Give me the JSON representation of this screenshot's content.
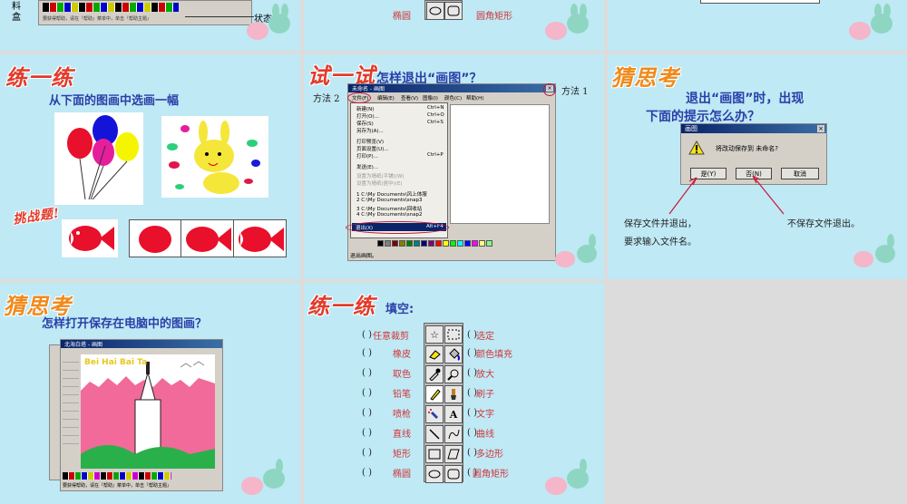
{
  "top_left": {
    "label_toolbox": "料\n盒",
    "label_statusbar": "状态栏",
    "status_text": "要获得帮助，请在『帮助』菜单中，单击『帮助主题』"
  },
  "top_middle": {
    "label_ellipse": "椭圆",
    "label_rounded_rect": "圆角矩形"
  },
  "practice1": {
    "heading": "练一练",
    "title": "从下面的图画中选画一幅",
    "challenge": "挑战题!"
  },
  "try_it": {
    "heading": "试一试",
    "title": "怎样退出“画图”？",
    "method2": "方法 2",
    "method1": "方法 1",
    "window_title": "未命名 - 画图",
    "menu_bar": [
      "文件(F)",
      "编辑(E)",
      "查看(V)",
      "图像(I)",
      "颜色(C)",
      "帮助(H)"
    ],
    "file_menu": [
      {
        "label": "新建(N)",
        "shortcut": "Ctrl+N"
      },
      {
        "label": "打开(O)...",
        "shortcut": "Ctrl+O"
      },
      {
        "label": "保存(S)",
        "shortcut": "Ctrl+S"
      },
      {
        "label": "另存为(A)...",
        "shortcut": ""
      },
      {
        "label": "打印预览(V)",
        "shortcut": ""
      },
      {
        "label": "页面设置(U)...",
        "shortcut": ""
      },
      {
        "label": "打印(P)...",
        "shortcut": "Ctrl+P"
      },
      {
        "label": "发送(E)...",
        "shortcut": ""
      },
      {
        "label": "设置为墙纸(平铺)(W)",
        "shortcut": ""
      },
      {
        "label": "设置为墙纸(居中)(E)",
        "shortcut": ""
      },
      {
        "label": "1 C:\\My Documents\\风上体服",
        "shortcut": ""
      },
      {
        "label": "2 C:\\My Documents\\snap3",
        "shortcut": ""
      },
      {
        "label": "3 C:\\My Documents\\回收站",
        "shortcut": ""
      },
      {
        "label": "4 C:\\My Documents\\snap2",
        "shortcut": ""
      }
    ],
    "exit_item": "退出(X)",
    "exit_shortcut": "Alt+F4",
    "status": "退出画图。"
  },
  "think1": {
    "heading": "猜思考",
    "title_line1": "退出“画图”时，出现",
    "title_line2": "下面的提示怎么办？",
    "dialog_title": "画图",
    "dialog_message": "将改动保存到 未命名?",
    "btn_yes": "是(Y)",
    "btn_no": "否(N)",
    "btn_cancel": "取消",
    "note_yes_line1": "保存文件并退出，",
    "note_yes_line2": "要求输入文件名。",
    "note_no": "不保存文件退出。"
  },
  "think2": {
    "heading": "猜思考",
    "title": "怎样打开保存在电脑中的图画？",
    "window_title": "北海白塔 - 画图",
    "picture_text": "Bei Hai Bai Ta",
    "status_text": "要获得帮助，请在『帮助』菜单中，单击『帮助主题』"
  },
  "practice2": {
    "heading": "练一练",
    "title": "填空:",
    "left_labels": [
      "任意裁剪",
      "橡皮",
      "取色",
      "铅笔",
      "喷枪",
      "直线",
      "矩形",
      "椭圆"
    ],
    "right_labels": [
      "选定",
      "颜色填充",
      "放大",
      "刷子",
      "文字",
      "曲线",
      "多边形",
      "圆角矩形"
    ],
    "paren": "( )"
  },
  "colors": {
    "slide_bg": "#bfe9f5",
    "heading_red": "#e23a2a",
    "title_blue": "#2a3fa8",
    "answer_red": "#d0363a"
  }
}
